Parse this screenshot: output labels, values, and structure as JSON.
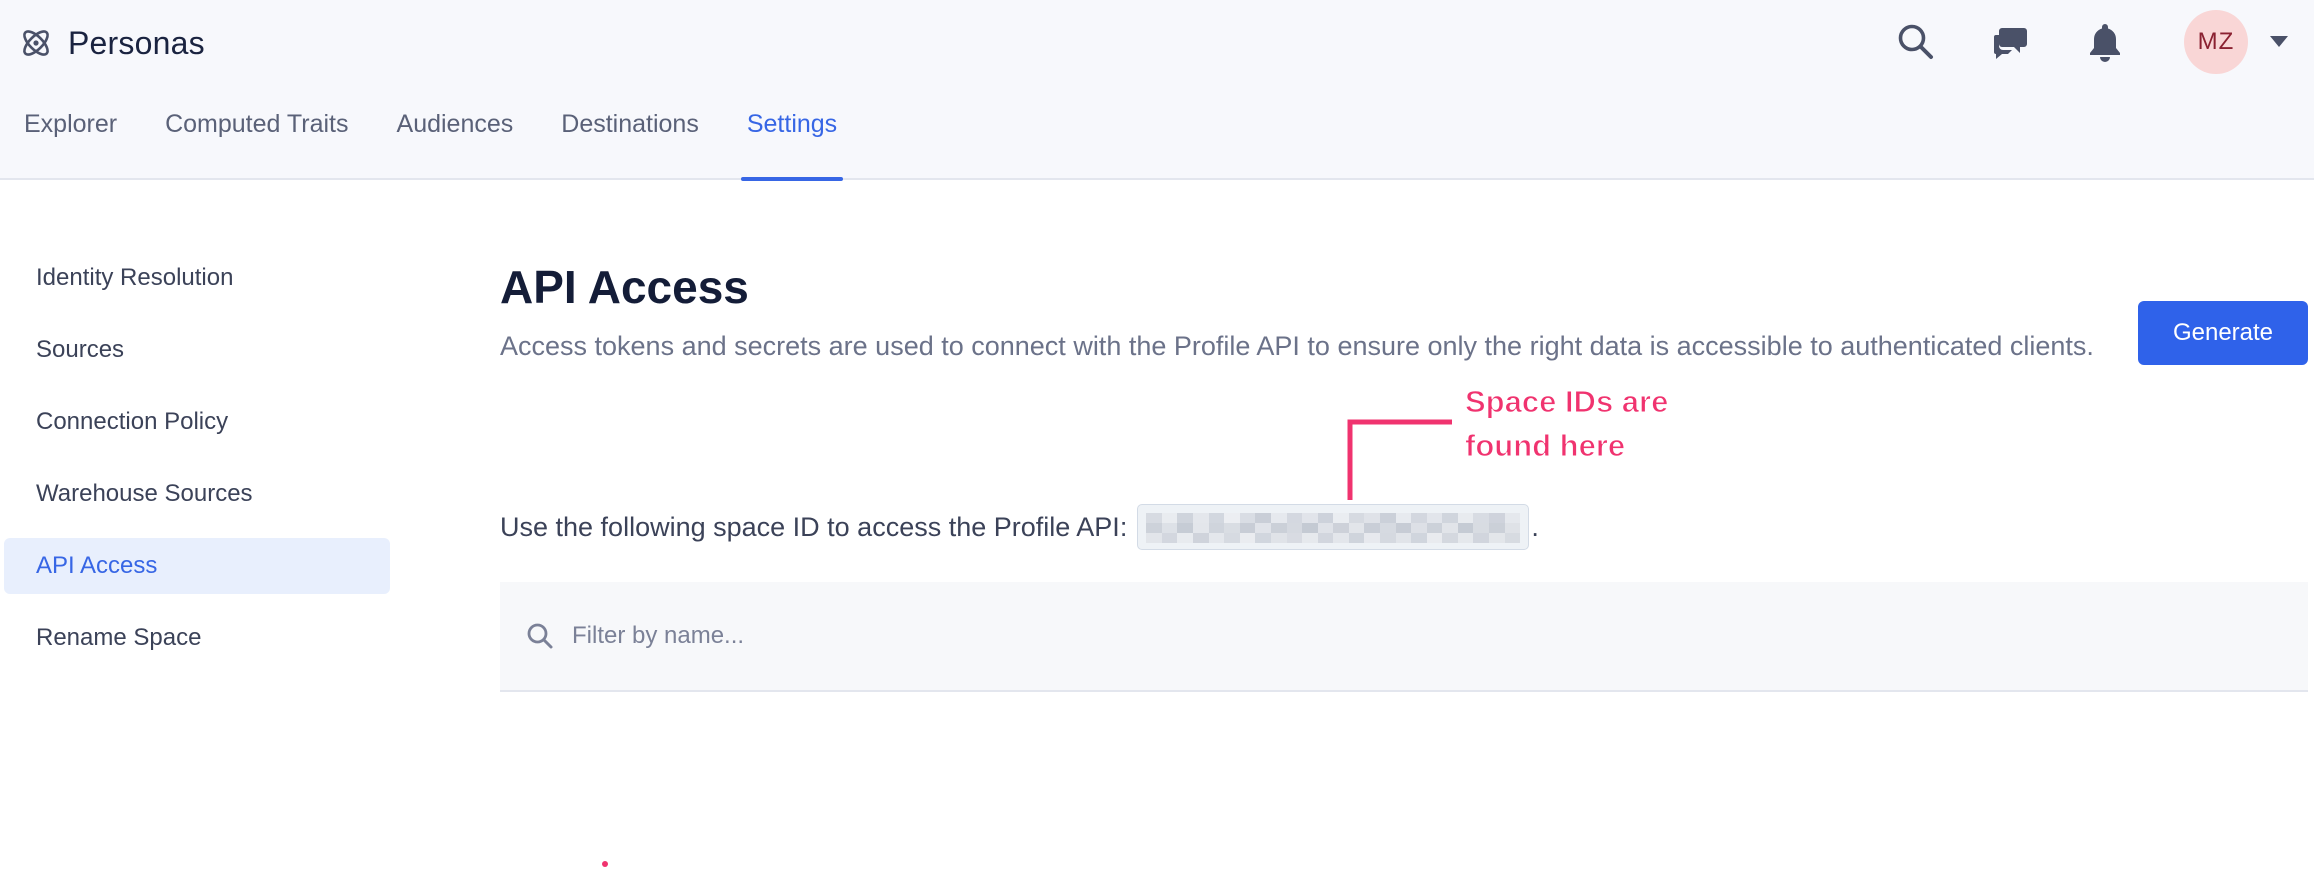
{
  "app": {
    "name": "Personas",
    "logo_icon": "atom-logo-icon"
  },
  "header": {
    "icons": [
      "search-icon",
      "chat-icon",
      "bell-icon"
    ],
    "avatar_initials": "MZ",
    "avatar_color": "#f9d6d6"
  },
  "tabs": [
    {
      "label": "Explorer",
      "active": false
    },
    {
      "label": "Computed Traits",
      "active": false
    },
    {
      "label": "Audiences",
      "active": false
    },
    {
      "label": "Destinations",
      "active": false
    },
    {
      "label": "Settings",
      "active": true
    }
  ],
  "sidebar": {
    "items": [
      {
        "label": "Identity Resolution",
        "active": false
      },
      {
        "label": "Sources",
        "active": false
      },
      {
        "label": "Connection Policy",
        "active": false
      },
      {
        "label": "Warehouse Sources",
        "active": false
      },
      {
        "label": "API Access",
        "active": true
      },
      {
        "label": "Rename Space",
        "active": false
      }
    ]
  },
  "main": {
    "title": "API Access",
    "description": "Access tokens and secrets are used to connect with the Profile API to ensure only the right data is accessible to authenticated clients.",
    "generate_label": "Generate",
    "space_id_prompt": "Use the following space ID to access the Profile API:",
    "space_id_suffix": ".",
    "space_id_state": "redacted (pixelated)",
    "filter_placeholder": "Filter by name..."
  },
  "annotation": {
    "line1": "Space IDs are",
    "line2": "found here",
    "color": "#f0336f"
  },
  "colors": {
    "accent": "#3766e5",
    "button": "#2f62ea",
    "header_bg": "#f7f8fc"
  }
}
